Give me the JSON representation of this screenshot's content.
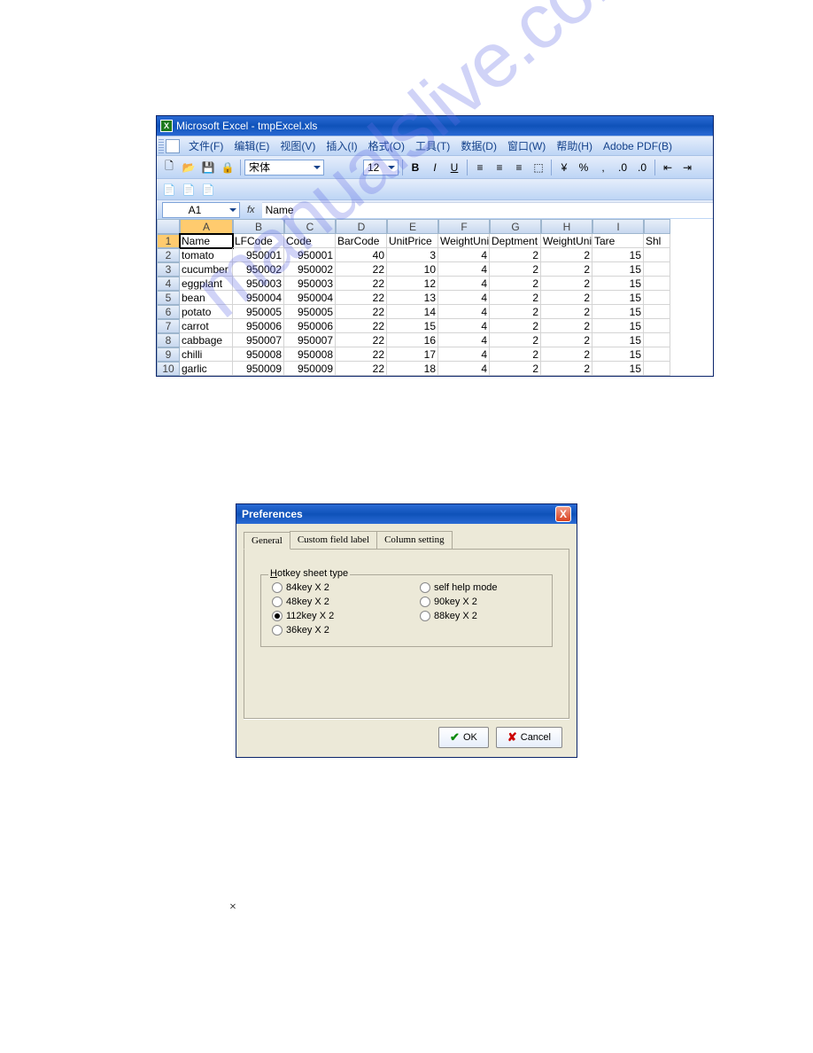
{
  "excel": {
    "title": "Microsoft Excel - tmpExcel.xls",
    "menu": [
      "文件(F)",
      "编辑(E)",
      "视图(V)",
      "插入(I)",
      "格式(O)",
      "工具(T)",
      "数据(D)",
      "窗口(W)",
      "帮助(H)",
      "Adobe PDF(B)"
    ],
    "font_name": "宋体",
    "font_size": "12",
    "namebox": "A1",
    "fx_label": "fx",
    "formula_value": "Name",
    "column_headers": [
      "A",
      "B",
      "C",
      "D",
      "E",
      "F",
      "G",
      "H",
      "I",
      ""
    ],
    "headers_row": [
      "Name",
      "LFCode",
      "Code",
      "BarCode",
      "UnitPrice",
      "WeightUni",
      "Deptment",
      "WeightUni",
      "Tare",
      "Shl"
    ],
    "rows": [
      {
        "n": "2",
        "c": [
          "tomato",
          "950001",
          "950001",
          "40",
          "3",
          "4",
          "2",
          "2",
          "15",
          ""
        ]
      },
      {
        "n": "3",
        "c": [
          "cucumber",
          "950002",
          "950002",
          "22",
          "10",
          "4",
          "2",
          "2",
          "15",
          ""
        ]
      },
      {
        "n": "4",
        "c": [
          "eggplant",
          "950003",
          "950003",
          "22",
          "12",
          "4",
          "2",
          "2",
          "15",
          ""
        ]
      },
      {
        "n": "5",
        "c": [
          "bean",
          "950004",
          "950004",
          "22",
          "13",
          "4",
          "2",
          "2",
          "15",
          ""
        ]
      },
      {
        "n": "6",
        "c": [
          "potato",
          "950005",
          "950005",
          "22",
          "14",
          "4",
          "2",
          "2",
          "15",
          ""
        ]
      },
      {
        "n": "7",
        "c": [
          "carrot",
          "950006",
          "950006",
          "22",
          "15",
          "4",
          "2",
          "2",
          "15",
          ""
        ]
      },
      {
        "n": "8",
        "c": [
          "cabbage",
          "950007",
          "950007",
          "22",
          "16",
          "4",
          "2",
          "2",
          "15",
          ""
        ]
      },
      {
        "n": "9",
        "c": [
          "chilli",
          "950008",
          "950008",
          "22",
          "17",
          "4",
          "2",
          "2",
          "15",
          ""
        ]
      },
      {
        "n": "10",
        "c": [
          "garlic",
          "950009",
          "950009",
          "22",
          "18",
          "4",
          "2",
          "2",
          "15",
          ""
        ]
      }
    ],
    "selected_cell": "A1"
  },
  "dialog": {
    "title": "Preferences",
    "close": "X",
    "tabs": [
      "General",
      "Custom field label",
      "Column setting"
    ],
    "active_tab": 0,
    "fieldset_label": "Hotkey sheet type",
    "radios": [
      {
        "label": "84key X 2",
        "checked": false
      },
      {
        "label": "self help mode",
        "checked": false
      },
      {
        "label": "48key X 2",
        "checked": false
      },
      {
        "label": "90key X 2",
        "checked": false
      },
      {
        "label": "112key X 2",
        "checked": true
      },
      {
        "label": "88key X 2",
        "checked": false
      },
      {
        "label": "36key X 2",
        "checked": false
      }
    ],
    "ok": "OK",
    "cancel": "Cancel"
  },
  "watermark": "manualslive.com",
  "stray": "×",
  "icons": {
    "bold": "B",
    "italic": "I",
    "underline": "U",
    "percent": "%",
    "comma": ",",
    "currency": "¥"
  }
}
